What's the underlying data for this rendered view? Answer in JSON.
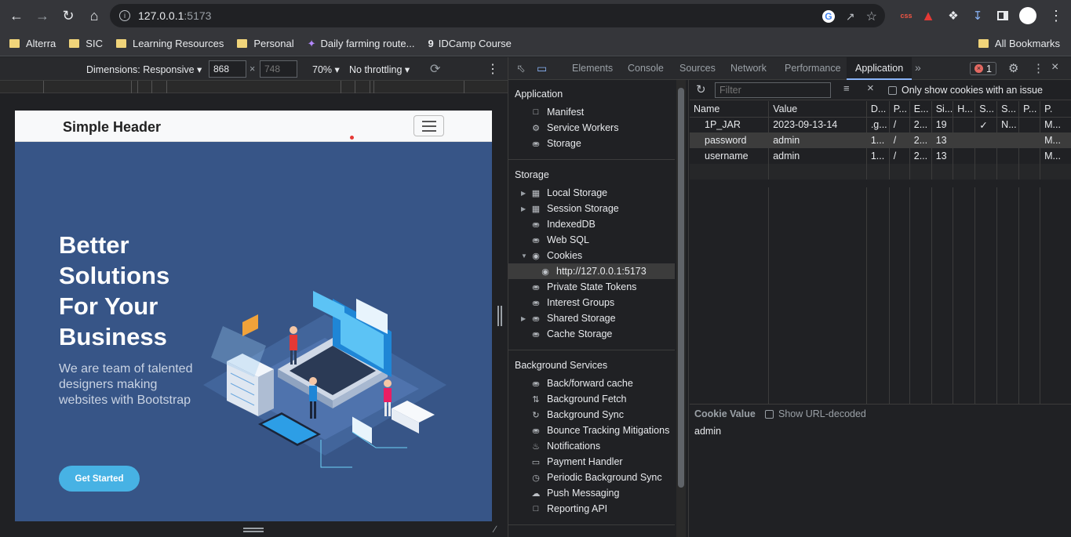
{
  "browser": {
    "url_host": "127.0.0.1",
    "url_port": ":5173",
    "bookmarks": [
      "Alterra",
      "SIC",
      "Learning Resources",
      "Personal",
      "Daily farming route...",
      "IDCamp Course"
    ],
    "all_bookmarks": "All Bookmarks"
  },
  "device_toolbar": {
    "dimensions": "Dimensions: Responsive",
    "width": "868",
    "height": "748",
    "zoom": "70%",
    "throttling": "No throttling"
  },
  "page": {
    "brand": "Simple Header",
    "hero_title": "Better Solutions For Your Business",
    "hero_subtitle": "We are team of talented designers making websites with Bootstrap",
    "cta": "Get Started"
  },
  "devtools": {
    "tabs": [
      "Elements",
      "Console",
      "Sources",
      "Network",
      "Performance",
      "Application"
    ],
    "error_count": "1",
    "sidebar": {
      "application_header": "Application",
      "application_items": [
        "Manifest",
        "Service Workers",
        "Storage"
      ],
      "storage_header": "Storage",
      "storage_items": [
        "Local Storage",
        "Session Storage",
        "IndexedDB",
        "Web SQL",
        "Cookies",
        "http://127.0.0.1:5173",
        "Private State Tokens",
        "Interest Groups",
        "Shared Storage",
        "Cache Storage"
      ],
      "background_header": "Background Services",
      "background_items": [
        "Back/forward cache",
        "Background Fetch",
        "Background Sync",
        "Bounce Tracking Mitigations",
        "Notifications",
        "Payment Handler",
        "Periodic Background Sync",
        "Push Messaging",
        "Reporting API"
      ]
    },
    "cookies": {
      "filter_placeholder": "Filter",
      "only_issue_label": "Only show cookies with an issue",
      "columns": [
        "Name",
        "Value",
        "D...",
        "P...",
        "E...",
        "Si...",
        "H...",
        "S...",
        "S...",
        "P...",
        "P."
      ],
      "rows": [
        [
          "1P_JAR",
          "2023-09-13-14",
          ".g...",
          "/",
          "2...",
          "19",
          "",
          "✓",
          "N...",
          "",
          "M..."
        ],
        [
          "password",
          "admin",
          "1...",
          "/",
          "2...",
          "13",
          "",
          "",
          "",
          "",
          "M..."
        ],
        [
          "username",
          "admin",
          "1...",
          "/",
          "2...",
          "13",
          "",
          "",
          "",
          "",
          "M..."
        ]
      ],
      "cookie_value_label": "Cookie Value",
      "url_decoded_label": "Show URL-decoded",
      "cookie_value": "admin"
    }
  },
  "colors": {
    "accent": "#8ab4f8",
    "hero_bg": "#375587",
    "cta": "#47b2e4"
  }
}
